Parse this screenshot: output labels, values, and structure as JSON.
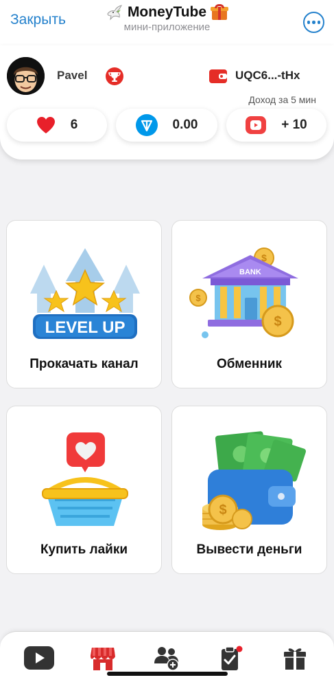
{
  "header": {
    "close_label": "Закрыть",
    "title": "MoneyTube",
    "subtitle": "мини-приложение",
    "title_icons": [
      "dove-icon",
      "gift-icon"
    ],
    "more_icon": "more-icon"
  },
  "profile": {
    "username": "Pavel",
    "badge_icon": "trophy-icon",
    "wallet_icon": "wallet-icon",
    "wallet_id": "UQC6...-tHx",
    "income_label": "Доход за 5 мин"
  },
  "stats": [
    {
      "icon": "heart-icon",
      "value": "6"
    },
    {
      "icon": "ton-icon",
      "value": "0.00"
    },
    {
      "icon": "youtube-icon",
      "value": "+ 10"
    }
  ],
  "cards": [
    {
      "label": "Прокачать канал",
      "illustration_text": "LEVEL UP",
      "icon": "level-up-icon"
    },
    {
      "label": "Обменник",
      "illustration_text": "BANK",
      "icon": "bank-icon"
    },
    {
      "label": "Купить лайки",
      "icon": "basket-heart-icon"
    },
    {
      "label": "Вывести деньги",
      "icon": "wallet-money-icon"
    }
  ],
  "nav": [
    {
      "icon": "youtube-icon",
      "active": false
    },
    {
      "icon": "shop-icon",
      "active": true
    },
    {
      "icon": "add-friends-icon",
      "active": false
    },
    {
      "icon": "tasks-icon",
      "active": false,
      "has_notification_dot": true
    },
    {
      "icon": "gift-icon",
      "active": false
    }
  ],
  "colors": {
    "accent_blue": "#2481cc",
    "brand_red": "#e52d27",
    "active_nav": "#d82b2b",
    "ton_blue": "#0098ea"
  }
}
